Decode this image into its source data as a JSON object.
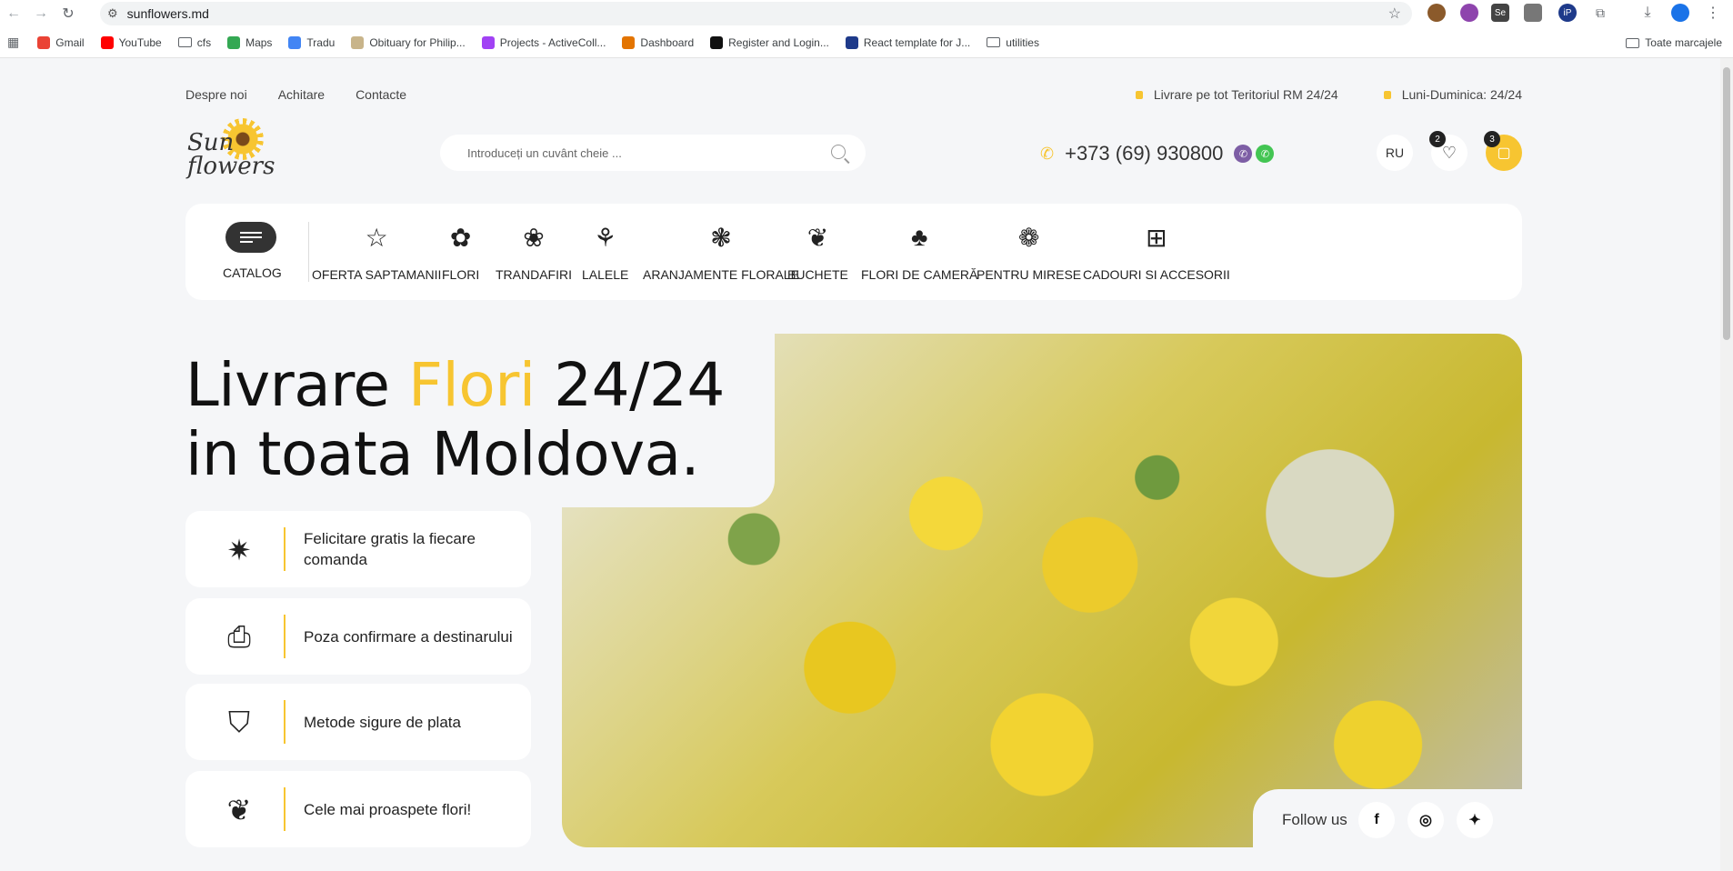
{
  "browser": {
    "url": "sunflowers.md",
    "bookmarks": [
      {
        "label": "Gmail",
        "color": "#ea4335"
      },
      {
        "label": "YouTube",
        "color": "#ff0000"
      },
      {
        "label": "cfs",
        "folder": true
      },
      {
        "label": "Maps",
        "color": "#34a853"
      },
      {
        "label": "Tradu",
        "color": "#4285f4"
      },
      {
        "label": "Obituary for Philip...",
        "color": "#c8b48a"
      },
      {
        "label": "Projects - ActiveColl...",
        "color": "#a142f4"
      },
      {
        "label": "Dashboard",
        "color": "#e37400"
      },
      {
        "label": "Register and Login...",
        "color": "#111111"
      },
      {
        "label": "React template for J...",
        "color": "#1e3a8a"
      },
      {
        "label": "utilities",
        "folder": true
      }
    ],
    "all_bookmarks": "Toate marcajele"
  },
  "site": {
    "top_links": [
      "Despre noi",
      "Achitare",
      "Contacte"
    ],
    "delivery_info": "Livrare pe tot Teritoriul RM 24/24",
    "hours_info": "Luni-Duminica: 24/24",
    "logo_line1": "Sun",
    "logo_line2": "flowers",
    "search_placeholder": "Introduceți un cuvânt cheie ...",
    "phone": "+373 (69) 930800",
    "language": "RU",
    "wishlist_count": "2",
    "cart_count": "3",
    "catalog_label": "CATALOG",
    "categories": [
      {
        "label": "OFERTA SAPTAMANII",
        "icon": "star-icon"
      },
      {
        "label": "FLORI",
        "icon": "flower-icon"
      },
      {
        "label": "TRANDAFIRI",
        "icon": "rose-icon"
      },
      {
        "label": "LALELE",
        "icon": "tulip-icon"
      },
      {
        "label": "ARANJAMENTE FLORALE",
        "icon": "arrangement-icon"
      },
      {
        "label": "BUCHETE",
        "icon": "bouquet-icon"
      },
      {
        "label": "FLORI DE CAMERĂ",
        "icon": "potted-plant-icon"
      },
      {
        "label": "PENTRU MIRESE",
        "icon": "bridal-bouquet-icon"
      },
      {
        "label": "CADOURI SI ACCESORII",
        "icon": "gift-icon"
      }
    ],
    "hero": {
      "line1_a": "Livrare",
      "line1_b": "Flori",
      "line1_c": "24/24",
      "line2": "in toata Moldova."
    },
    "features": [
      {
        "text": "Felicitare gratis la fiecare comanda",
        "icon": "party-popper-icon"
      },
      {
        "text": "Poza confirmare a destinarului",
        "icon": "camera-icon"
      },
      {
        "text": "Metode sigure de plata",
        "icon": "shield-check-icon"
      },
      {
        "text": "Cele mai proaspete flori!",
        "icon": "bouquet-icon"
      }
    ],
    "follow_label": "Follow us",
    "accent_color": "#f7c531"
  }
}
